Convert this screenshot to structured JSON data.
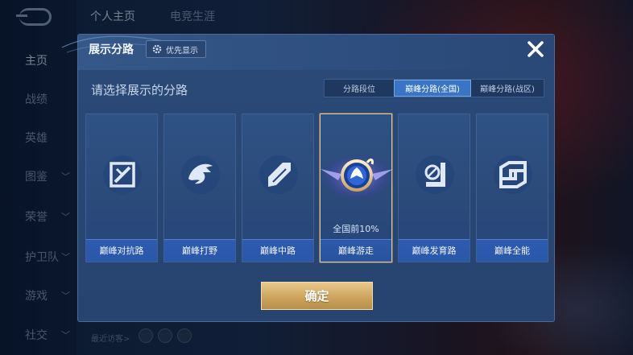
{
  "left_nav": {
    "items": [
      {
        "label": "主页",
        "has_chevron": false,
        "active": true
      },
      {
        "label": "战绩",
        "has_chevron": false
      },
      {
        "label": "英雄",
        "has_chevron": false
      },
      {
        "label": "图鉴",
        "has_chevron": true
      },
      {
        "label": "荣誉",
        "has_chevron": true
      },
      {
        "label": "护卫队",
        "has_chevron": true
      },
      {
        "label": "游戏",
        "has_chevron": true
      },
      {
        "label": "社交",
        "has_chevron": true
      }
    ]
  },
  "top_tabs": [
    {
      "label": "个人主页",
      "active": true
    },
    {
      "label": "电竞生涯",
      "active": false
    }
  ],
  "bottom": {
    "visitors_label": "最近访客>"
  },
  "dialog": {
    "title": "展示分路",
    "priority_button": "优先显示",
    "subtitle": "请选择展示的分路",
    "segments": [
      {
        "label": "分路段位",
        "active": false
      },
      {
        "label": "巅峰分路(全国)",
        "active": true
      },
      {
        "label": "巅峰分路(战区)",
        "active": false
      }
    ],
    "cards": [
      {
        "label": "巅峰对抗路",
        "icon": "clash-lane-icon"
      },
      {
        "label": "巅峰打野",
        "icon": "jungle-icon"
      },
      {
        "label": "巅峰中路",
        "icon": "mid-lane-icon"
      },
      {
        "label": "巅峰游走",
        "icon": "roam-badge-icon",
        "selected": true,
        "rank": "全国前10%"
      },
      {
        "label": "巅峰发育路",
        "icon": "farm-lane-icon"
      },
      {
        "label": "巅峰全能",
        "icon": "all-round-icon"
      }
    ],
    "confirm_button": "确定"
  },
  "colors": {
    "accent_blue": "#3a74c4",
    "gold": "#cda55f",
    "dialog_bg": "#2a4a78"
  }
}
